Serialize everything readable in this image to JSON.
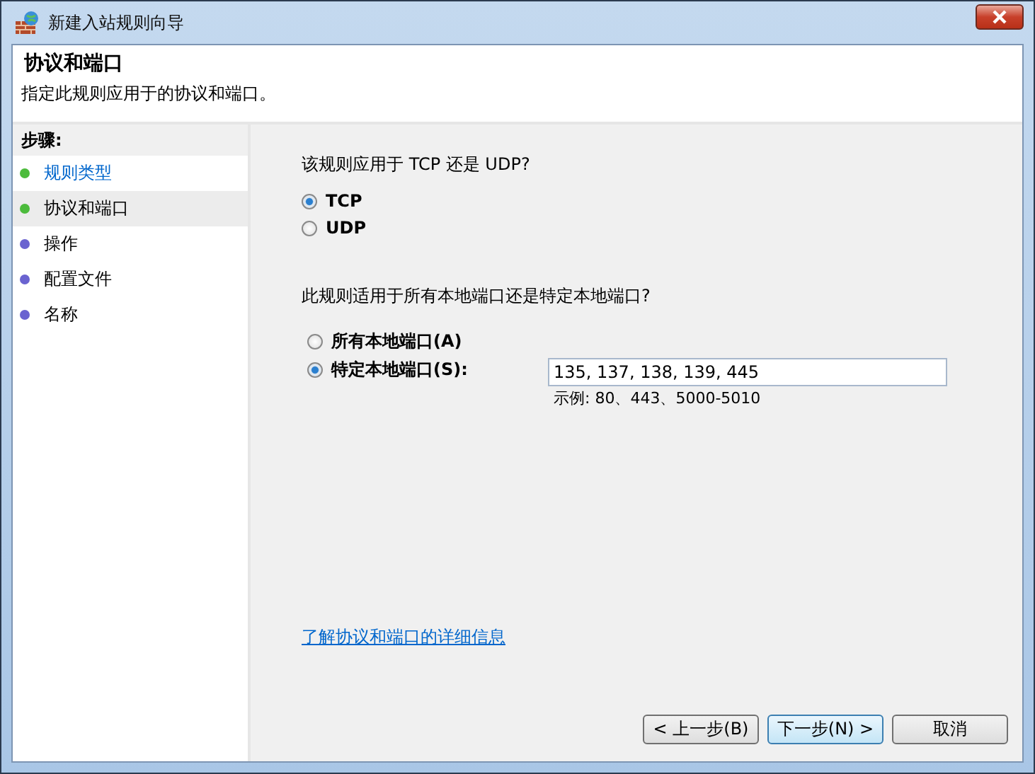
{
  "window": {
    "title": "新建入站规则向导"
  },
  "header": {
    "title": "协议和端口",
    "subtitle": "指定此规则应用于的协议和端口。"
  },
  "steps": {
    "heading": "步骤:",
    "items": [
      {
        "label": "规则类型",
        "color": "#4cbb3c",
        "selected": false,
        "link": true
      },
      {
        "label": "协议和端口",
        "color": "#4cbb3c",
        "selected": true,
        "link": false
      },
      {
        "label": "操作",
        "color": "#6a63d0",
        "selected": false,
        "link": false
      },
      {
        "label": "配置文件",
        "color": "#6a63d0",
        "selected": false,
        "link": false
      },
      {
        "label": "名称",
        "color": "#6a63d0",
        "selected": false,
        "link": false
      }
    ]
  },
  "protocol": {
    "question": "该规则应用于 TCP 还是 UDP?",
    "options": [
      {
        "label": "TCP",
        "selected": true
      },
      {
        "label": "UDP",
        "selected": false
      }
    ]
  },
  "ports": {
    "question": "此规则适用于所有本地端口还是特定本地端口?",
    "options": [
      {
        "label": "所有本地端口(A)",
        "selected": false
      },
      {
        "label": "特定本地端口(S):",
        "selected": true
      }
    ],
    "value": "135, 137, 138, 139, 445",
    "example": "示例: 80、443、5000-5010"
  },
  "link": "了解协议和端口的详细信息",
  "buttons": [
    {
      "label": "< 上一步(B)",
      "default": false
    },
    {
      "label": "下一步(N) >",
      "default": true
    },
    {
      "label": "取消",
      "default": false
    }
  ]
}
